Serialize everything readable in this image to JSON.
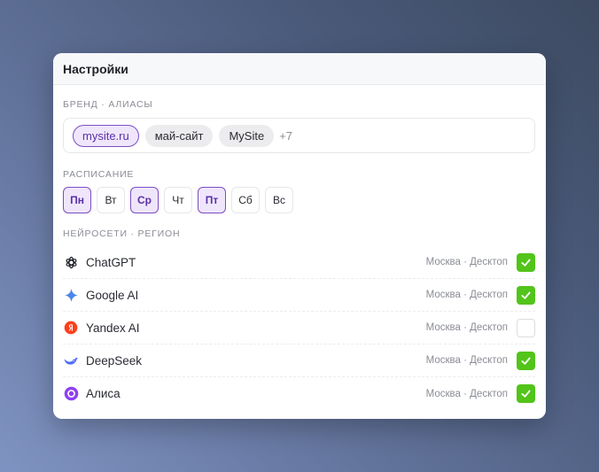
{
  "header": {
    "title": "Настройки"
  },
  "brand": {
    "label": "БРЕНД · АЛИАСЫ",
    "chips": [
      {
        "text": "mysite.ru",
        "active": true
      },
      {
        "text": "май-сайт",
        "active": false
      },
      {
        "text": "MySite",
        "active": false
      }
    ],
    "more": "+7"
  },
  "schedule": {
    "label": "РАСПИСАНИЕ",
    "days": [
      {
        "text": "Пн",
        "active": true
      },
      {
        "text": "Вт",
        "active": false
      },
      {
        "text": "Ср",
        "active": true
      },
      {
        "text": "Чт",
        "active": false
      },
      {
        "text": "Пт",
        "active": true
      },
      {
        "text": "Сб",
        "active": false
      },
      {
        "text": "Вс",
        "active": false
      }
    ]
  },
  "ai": {
    "label": "НЕЙРОСЕТИ · РЕГИОН",
    "items": [
      {
        "name": "ChatGPT",
        "region": "Москва · Десктоп",
        "checked": true,
        "icon": "chatgpt-icon"
      },
      {
        "name": "Google AI",
        "region": "Москва · Десктоп",
        "checked": true,
        "icon": "google-ai-icon"
      },
      {
        "name": "Yandex AI",
        "region": "Москва · Десктоп",
        "checked": false,
        "icon": "yandex-icon"
      },
      {
        "name": "DeepSeek",
        "region": "Москва · Десктоп",
        "checked": true,
        "icon": "deepseek-icon"
      },
      {
        "name": "Алиса",
        "region": "Москва · Десктоп",
        "checked": true,
        "icon": "alice-icon"
      }
    ]
  },
  "colors": {
    "accent": "#7c4dc4",
    "check": "#52c41a",
    "yandex": "#fc3f1d",
    "alice": "#8f3ff5",
    "google": "#4a86e8",
    "deepseek": "#4d6bfe"
  }
}
